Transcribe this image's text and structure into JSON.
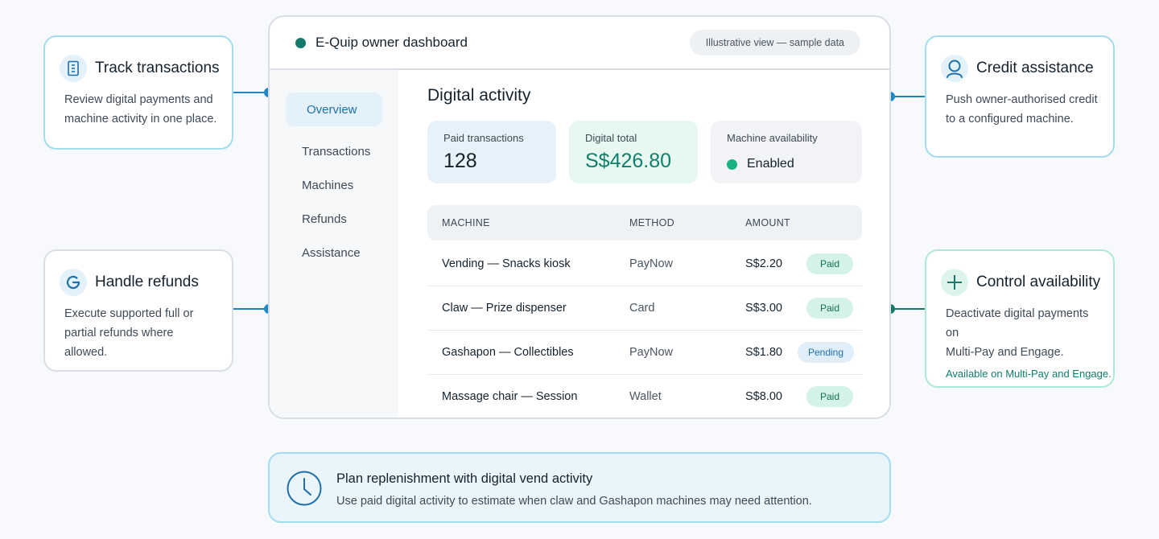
{
  "dashboard": {
    "title": "E-Quip owner dashboard",
    "pill": "Illustrative view — sample data",
    "nav": [
      "Overview",
      "Transactions",
      "Machines",
      "Refunds",
      "Assistance"
    ],
    "active_nav": "Overview",
    "section_title": "Digital activity",
    "stats": {
      "paid_label": "Paid transactions",
      "paid_value": "128",
      "total_label": "Digital total",
      "total_value": "S$426.80",
      "availability_label": "Machine availability",
      "availability_value": "Enabled"
    },
    "table": {
      "headers": [
        "MACHINE",
        "METHOD",
        "AMOUNT"
      ],
      "rows": [
        {
          "machine": "Vending — Snacks kiosk",
          "method": "PayNow",
          "amount": "S$2.20",
          "status": "Paid"
        },
        {
          "machine": "Claw — Prize dispenser",
          "method": "Card",
          "amount": "S$3.00",
          "status": "Paid"
        },
        {
          "machine": "Gashapon — Collectibles",
          "method": "PayNow",
          "amount": "S$1.80",
          "status": "Pending"
        },
        {
          "machine": "Massage chair — Session",
          "method": "Wallet",
          "amount": "S$8.00",
          "status": "Paid"
        }
      ]
    }
  },
  "features": {
    "track": {
      "title": "Track transactions",
      "text_l1": "Review digital payments and",
      "text_l2": "machine activity in one place.",
      "icon": "receipt-icon"
    },
    "refunds": {
      "title": "Handle refunds",
      "text_l1": "Execute supported full or",
      "text_l2": "partial refunds where allowed.",
      "icon": "refund-icon"
    },
    "credit": {
      "title": "Credit assistance",
      "text_l1": "Push owner-authorised credit",
      "text_l2": "to a configured machine.",
      "icon": "person-search-icon"
    },
    "availability": {
      "title": "Control availability",
      "text_l1": "Deactivate digital payments on",
      "text_l2": "Multi-Pay and Engage.",
      "note": "Available on Multi-Pay and Engage.",
      "icon": "plus-icon"
    }
  },
  "banner": {
    "title": "Plan replenishment with digital vend activity",
    "text": "Use paid digital activity to estimate when claw and Gashapon machines may need attention.",
    "icon": "clock-icon"
  },
  "colors": {
    "accent_blue": "#1f86c4",
    "accent_teal": "#167a6a",
    "card_border": "#a5dced",
    "paid_badge": "#d4f3e6",
    "pending_badge": "#dfeef9"
  }
}
